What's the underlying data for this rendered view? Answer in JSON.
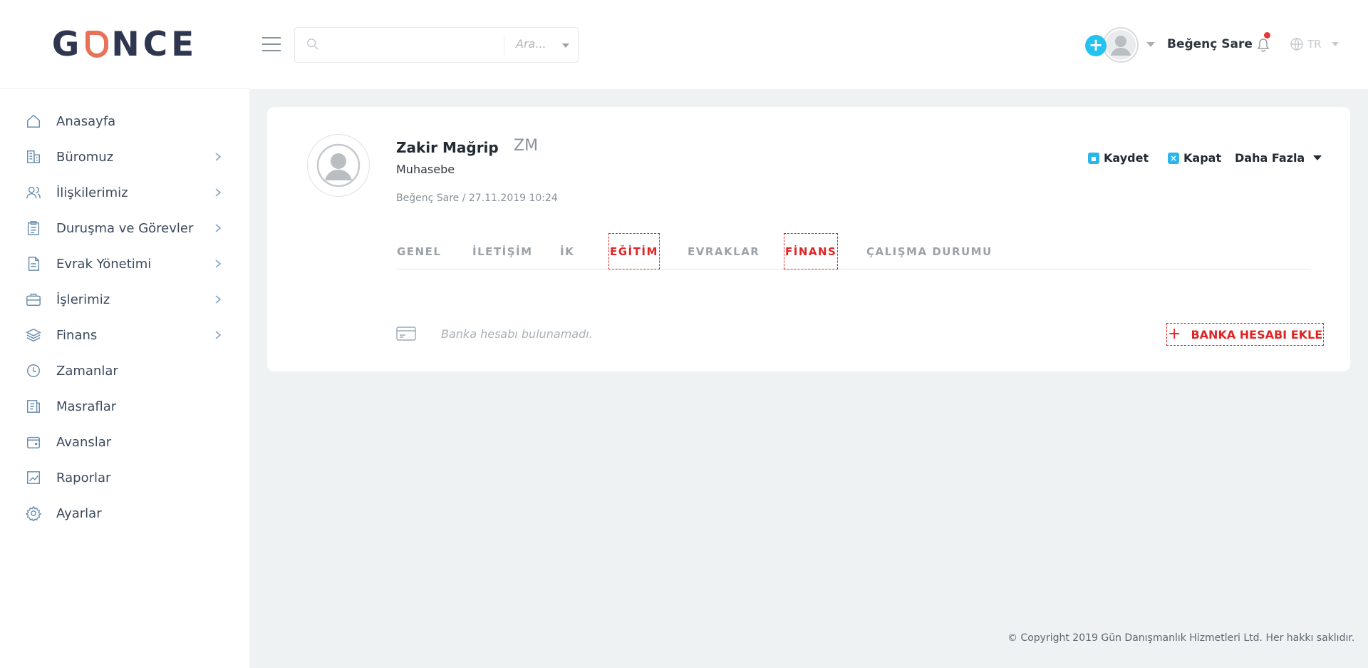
{
  "brand": {
    "logo_text_left": "G",
    "logo_text_right": "NCE"
  },
  "sidebar": {
    "items": [
      {
        "label": "Anasayfa",
        "icon": "home-icon",
        "has_children": false
      },
      {
        "label": "Büromuz",
        "icon": "building-icon",
        "has_children": true
      },
      {
        "label": "İlişkilerimiz",
        "icon": "users-icon",
        "has_children": true
      },
      {
        "label": "Duruşma ve Görevler",
        "icon": "clipboard-icon",
        "has_children": true
      },
      {
        "label": "Evrak Yönetimi",
        "icon": "document-icon",
        "has_children": true
      },
      {
        "label": "İşlerimiz",
        "icon": "briefcase-icon",
        "has_children": true
      },
      {
        "label": "Finans",
        "icon": "coins-icon",
        "has_children": true
      },
      {
        "label": "Zamanlar",
        "icon": "clock-icon",
        "has_children": false
      },
      {
        "label": "Masraflar",
        "icon": "receipt-icon",
        "has_children": false
      },
      {
        "label": "Avanslar",
        "icon": "wallet-icon",
        "has_children": false
      },
      {
        "label": "Raporlar",
        "icon": "chart-icon",
        "has_children": false
      },
      {
        "label": "Ayarlar",
        "icon": "gear-icon",
        "has_children": false
      }
    ]
  },
  "header": {
    "search": {
      "placeholder": "",
      "scope_label": "Ara..."
    },
    "user": {
      "name": "Beğenç Sare"
    },
    "language": {
      "code": "TR"
    }
  },
  "profile": {
    "name": "Zakir Mağrip",
    "initials": "ZM",
    "department": "Muhasebe",
    "meta": "Beğenç Sare / 27.11.2019 10:24",
    "actions": {
      "save": "Kaydet",
      "close": "Kapat",
      "more": "Daha Fazla"
    }
  },
  "tabs": [
    {
      "label": "GENEL",
      "highlighted": false
    },
    {
      "label": "İLETİŞİM",
      "highlighted": false
    },
    {
      "label": "İK",
      "highlighted": false
    },
    {
      "label": "EĞİTİM",
      "highlighted": true
    },
    {
      "label": "EVRAKLAR",
      "highlighted": false
    },
    {
      "label": "FİNANS",
      "highlighted": true
    },
    {
      "label": "ÇALIŞMA DURUMU",
      "highlighted": false
    }
  ],
  "finance": {
    "empty_message": "Banka hesabı bulunamadı.",
    "add_button": "BANKA HESABI EKLE"
  },
  "footer": {
    "copyright": "© Copyright 2019 Gün Danışmanlık Hizmetleri Ltd. Her hakkı saklıdır."
  },
  "colors": {
    "accent": "#24c3ef",
    "highlight": "#e02424",
    "logo_accent": "#e8715a",
    "brand_dark": "#2e3650"
  }
}
